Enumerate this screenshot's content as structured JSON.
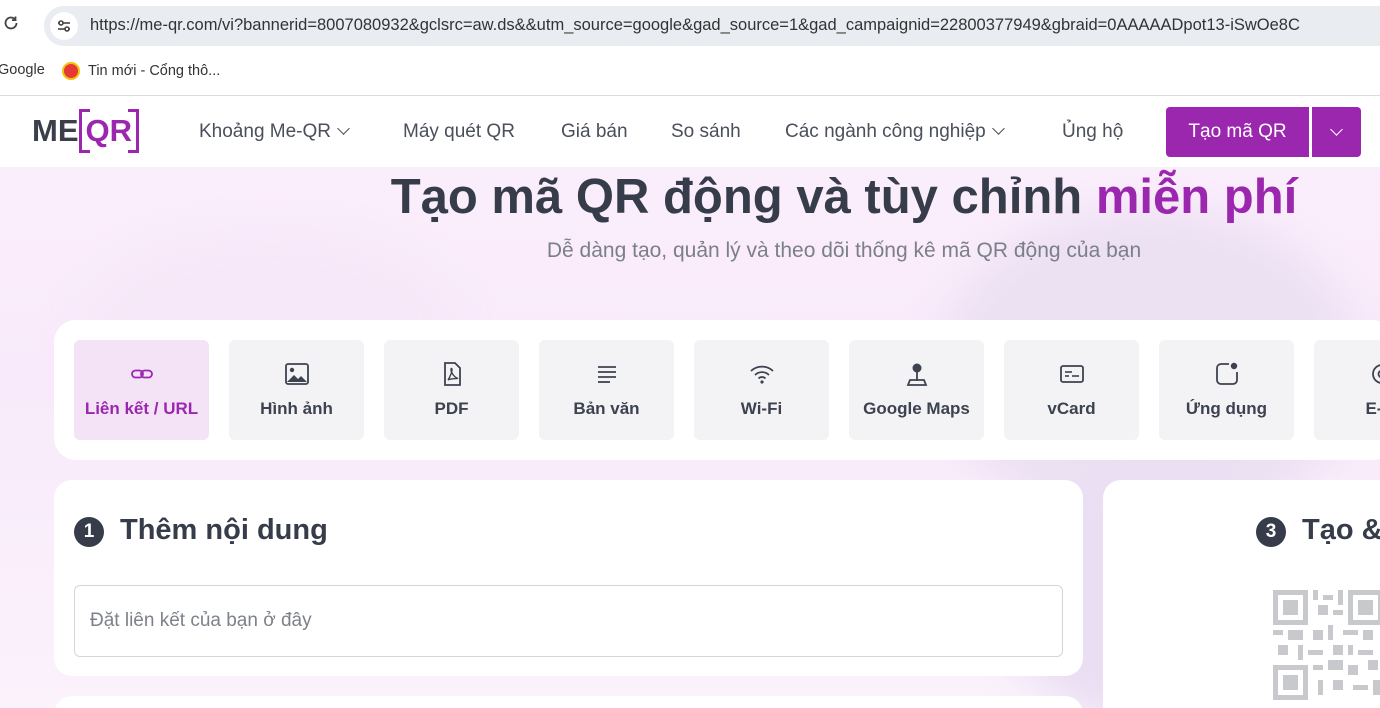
{
  "browser": {
    "url": "https://me-qr.com/vi?bannerid=8007080932&gclsrc=aw.ds&&utm_source=google&gad_source=1&gad_campaignid=22800377949&gbraid=0AAAAADpot13-iSwOe8C",
    "bookmarks": [
      {
        "label": "Google"
      },
      {
        "label": "Tin mới - Cổng thô..."
      }
    ]
  },
  "header": {
    "logo": {
      "me": "ME",
      "qr": "QR"
    },
    "nav": [
      {
        "label": "Khoảng Me-QR"
      },
      {
        "label": "Máy quét QR"
      },
      {
        "label": "Giá bán"
      },
      {
        "label": "So sánh"
      },
      {
        "label": "Các ngành công nghiệp"
      },
      {
        "label": "Ủng hộ"
      }
    ],
    "cta_label": "Tạo mã QR"
  },
  "hero": {
    "title_main": "Tạo mã QR động và tùy chỉnh ",
    "title_accent": "miễn phí",
    "subtitle": "Dễ dàng tạo, quản lý và theo dõi thống kê mã QR động của bạn"
  },
  "qr_types": [
    {
      "label": "Liên kết / URL",
      "icon": "link-icon",
      "active": true
    },
    {
      "label": "Hình ảnh",
      "icon": "image-icon"
    },
    {
      "label": "PDF",
      "icon": "pdf-icon"
    },
    {
      "label": "Bản văn",
      "icon": "text-icon"
    },
    {
      "label": "Wi-Fi",
      "icon": "wifi-icon"
    },
    {
      "label": "Google Maps",
      "icon": "map-pin-icon"
    },
    {
      "label": "vCard",
      "icon": "vcard-icon"
    },
    {
      "label": "Ứng dụng",
      "icon": "app-icon"
    },
    {
      "label": "E-m",
      "icon": "email-icon"
    }
  ],
  "step1": {
    "number": "1",
    "title": "Thêm nội dung",
    "placeholder": "Đặt liên kết của bạn ở đây"
  },
  "step3": {
    "number": "3",
    "title": "Tạo &"
  },
  "colors": {
    "accent": "#9b27af",
    "dark": "#363c4a"
  }
}
